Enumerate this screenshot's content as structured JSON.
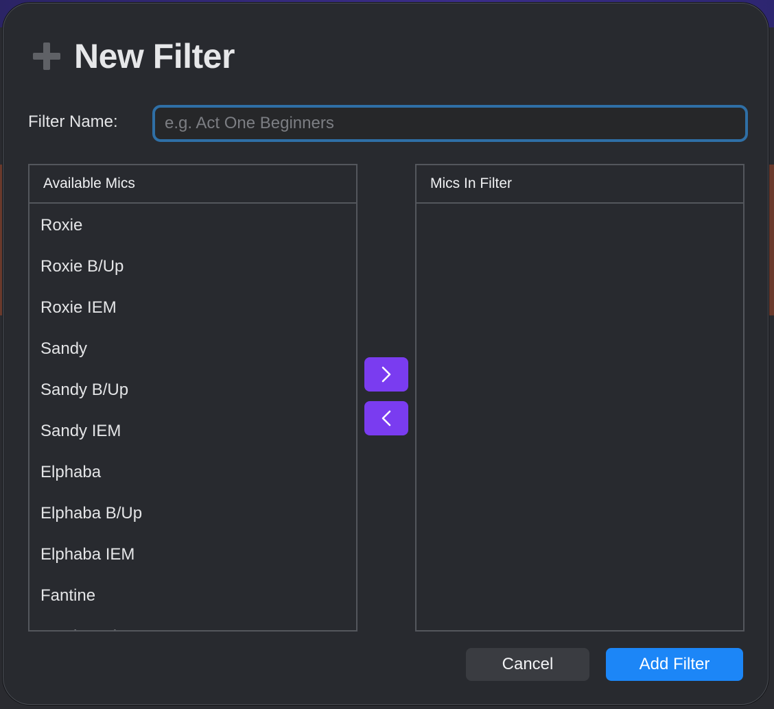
{
  "dialog": {
    "title": "New Filter",
    "icon": "plus-icon"
  },
  "filter_name": {
    "label": "Filter Name:",
    "value": "",
    "placeholder": "e.g. Act One Beginners"
  },
  "available": {
    "header": "Available Mics",
    "items": [
      {
        "label": "Roxie"
      },
      {
        "label": "Roxie B/Up"
      },
      {
        "label": "Roxie IEM"
      },
      {
        "label": "Sandy"
      },
      {
        "label": "Sandy B/Up"
      },
      {
        "label": "Sandy IEM"
      },
      {
        "label": "Elphaba"
      },
      {
        "label": "Elphaba B/Up"
      },
      {
        "label": "Elphaba IEM"
      },
      {
        "label": "Fantine"
      },
      {
        "label": "Fantine B/Up"
      }
    ]
  },
  "in_filter": {
    "header": "Mics In Filter",
    "items": []
  },
  "move_buttons": {
    "add_icon": "chevron-right-icon",
    "remove_icon": "chevron-left-icon"
  },
  "buttons": {
    "cancel_label": "Cancel",
    "add_label": "Add Filter"
  },
  "colors": {
    "accent_purple": "#7a3cf0",
    "primary_blue": "#1c86f7",
    "input_focus": "#2f6fa6"
  }
}
